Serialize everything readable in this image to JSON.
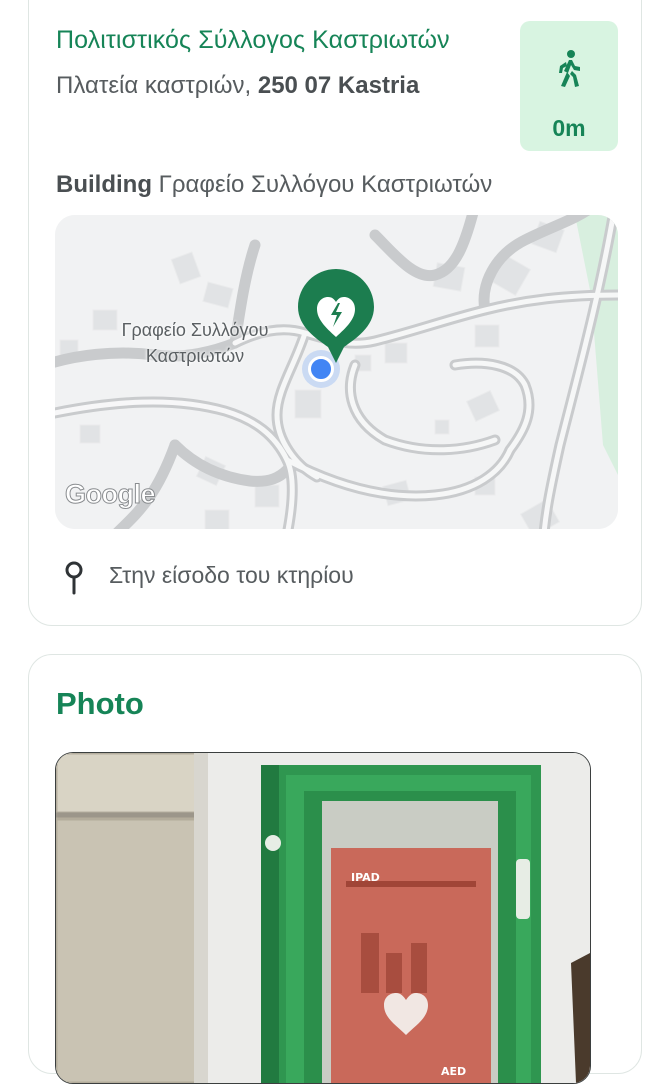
{
  "location": {
    "name": "Πολιτιστικός Σύλλογος Καστριωτών",
    "address_street": "Πλατεία καστριών,",
    "address_postcode": "250 07 Kastria",
    "walk": {
      "icon": "walking-person-icon",
      "distance": "0m"
    },
    "building_keyword": "Building",
    "building_name": "Γραφείο Συλλόγου Καστριωτών",
    "map": {
      "label_line1": "Γραφείο Συλλόγου",
      "label_line2": "Καστριωτών",
      "attribution": "Google",
      "marker_icon": "aed-heart-marker-icon"
    },
    "entrance_icon": "location-pin-icon",
    "entrance_text": "Στην είσοδο του κτηρίου"
  },
  "photo": {
    "title": "Photo",
    "image_text": "AED"
  },
  "colors": {
    "accent": "#168457",
    "walk_badge_bg": "#d8f4e1",
    "cabinet_green": "#2f9650"
  }
}
